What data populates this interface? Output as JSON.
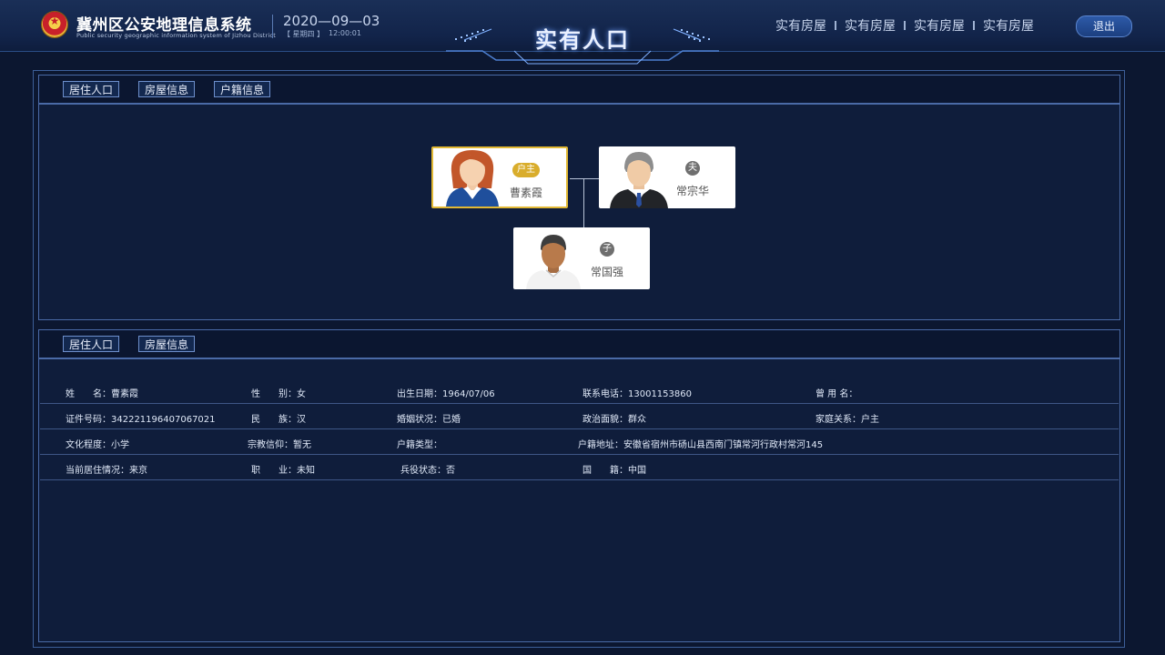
{
  "header": {
    "system_title": "冀州区公安地理信息系统",
    "system_subtitle": "Public security geographic information system of Jizhou District",
    "date": "2020—09—03",
    "weekday": "【 星期四 】",
    "time": "12:00:01",
    "page_title": "实有人口",
    "nav": [
      "实有房屋",
      "实有房屋",
      "实有房屋",
      "实有房屋"
    ],
    "logout": "退出"
  },
  "top_panel": {
    "tabs": [
      "居住人口",
      "房屋信息",
      "户籍信息"
    ]
  },
  "family_tree": {
    "members": [
      {
        "name": "曹素霞",
        "relation": "户主",
        "selected": true
      },
      {
        "name": "常宗华",
        "relation": "夫",
        "selected": false
      },
      {
        "name": "常国强",
        "relation": "子",
        "selected": false
      }
    ]
  },
  "bottom_panel": {
    "tabs": [
      "居住人口",
      "房屋信息"
    ],
    "rows": [
      [
        "姓　　名：曹素霞",
        "性　　别：女",
        "出生日期：1964/07/06",
        "联系电话：13001153860",
        "曾 用 名："
      ],
      [
        "证件号码：342221196407067021",
        "民　　族：汉",
        "婚姻状况：已婚",
        "政治面貌：群众",
        "家庭关系：户主"
      ],
      [
        "文化程度：小学",
        "宗教信仰：暂无",
        "户籍类型：",
        "户籍地址：安徽省宿州市砀山县西南门镇常河行政村常河145",
        ""
      ],
      [
        "当前居住情况：来京",
        "职　　业：未知",
        "兵役状态：否",
        "国　　籍：中国",
        ""
      ]
    ]
  },
  "colors": {
    "background": "#0c1730",
    "panel_border": "#4a6aa6",
    "selected_border": "#e2b934",
    "badge_gold": "#d9ad2c",
    "badge_gray": "#6f6f6f"
  }
}
